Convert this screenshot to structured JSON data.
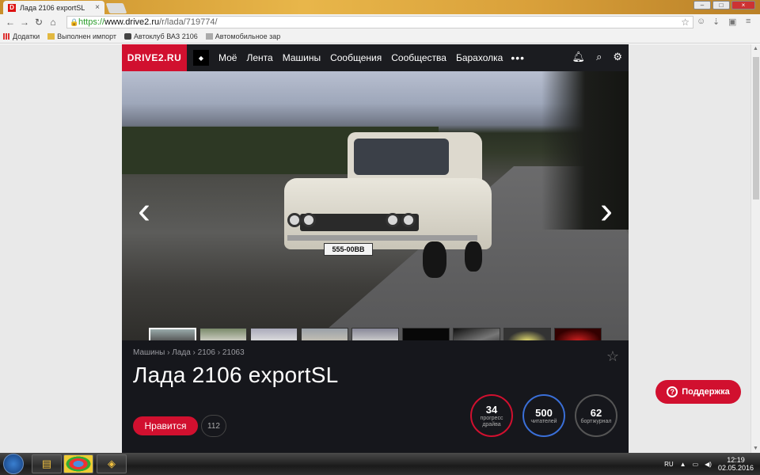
{
  "browser": {
    "tab_title": "Лада 2106 exportSL",
    "tab_favicon_letter": "D",
    "url_scheme": "https://",
    "url_host": "www.drive2.ru",
    "url_path": "/r/lada/719774/",
    "bookmarks": [
      {
        "label": "Додатки",
        "icon": "apps-grid-icon"
      },
      {
        "label": "Выполнен импорт",
        "icon": "folder-icon"
      },
      {
        "label": "Автоклуб ВАЗ 2106",
        "icon": "car-icon"
      },
      {
        "label": "Автомобильное зар",
        "icon": "page-icon"
      }
    ]
  },
  "site": {
    "logo": "DRIVE2.RU",
    "nav": [
      "Моё",
      "Лента",
      "Машины",
      "Сообщения",
      "Сообщества",
      "Барахолка"
    ],
    "more": "•••",
    "breadcrumb": [
      "Машины",
      "Лада",
      "2106",
      "21063"
    ],
    "breadcrumb_sep": "›",
    "title": "Лада 2106 exportSL",
    "like_label": "Нравится",
    "like_count": "112",
    "plate": "555-00BB",
    "stats": [
      {
        "value": "34",
        "label": "прогресс драйва",
        "color": "#d1102f"
      },
      {
        "value": "500",
        "label": "читателей",
        "color": "#3a6fd8"
      },
      {
        "value": "62",
        "label": "бортжурнал",
        "color": "#555555"
      }
    ],
    "support_label": "Поддержка",
    "thumbnail_count": 9,
    "active_thumbnail": 1
  },
  "taskbar": {
    "lang": "RU",
    "time": "12:19",
    "date": "02.05.2016"
  }
}
